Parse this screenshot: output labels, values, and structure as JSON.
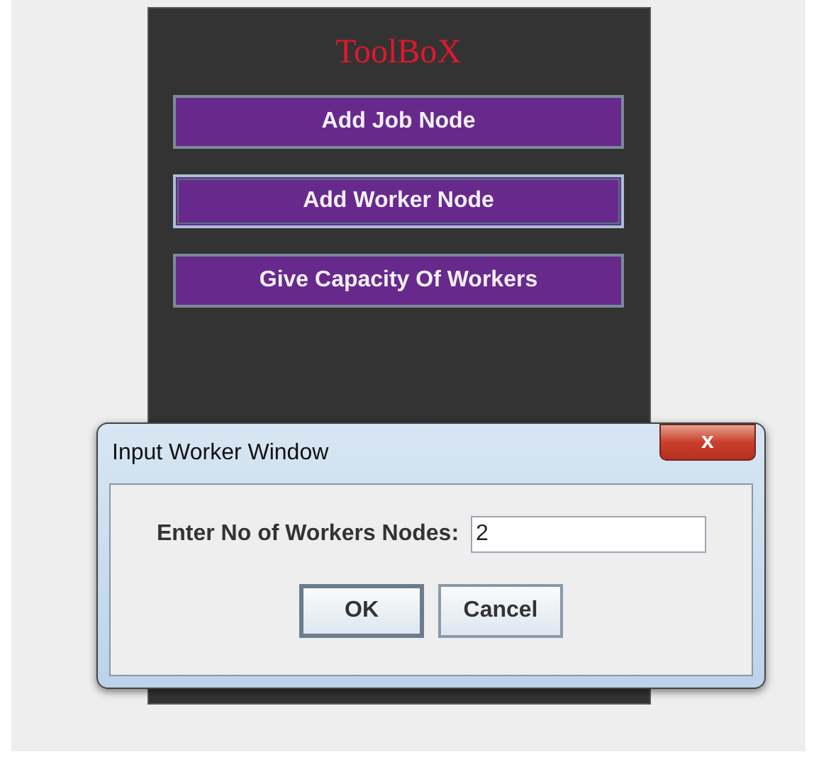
{
  "toolbox": {
    "title": "ToolBoX",
    "buttons": [
      {
        "label": "Add Job Node",
        "focused": false
      },
      {
        "label": "Add Worker Node",
        "focused": true
      },
      {
        "label": "Give Capacity Of Workers",
        "focused": false
      }
    ]
  },
  "dialog": {
    "title": "Input Worker Window",
    "close": "x",
    "prompt": "Enter No of Workers Nodes:",
    "value": "2",
    "buttons": [
      {
        "label": "OK",
        "default": true
      },
      {
        "label": "Cancel",
        "default": false
      }
    ]
  }
}
